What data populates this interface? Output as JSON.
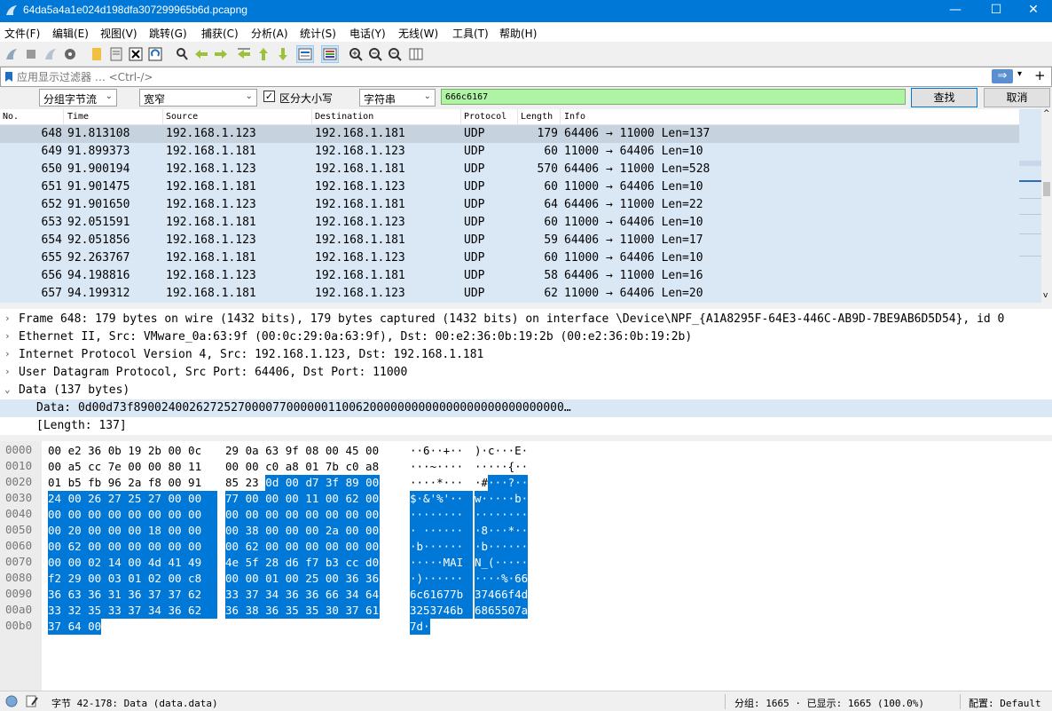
{
  "window": {
    "title": "64da5a4a1e024d198dfa307299965b6d.pcapng",
    "min": "—",
    "max": "☐",
    "close": "✕"
  },
  "menu": [
    "文件(F)",
    "编辑(E)",
    "视图(V)",
    "跳转(G)",
    "捕获(C)",
    "分析(A)",
    "统计(S)",
    "电话(Y)",
    "无线(W)",
    "工具(T)",
    "帮助(H)"
  ],
  "toolbar_icons": [
    "shark-fin-icon",
    "stop-icon",
    "restart-icon",
    "capture-options-icon",
    "open-file-icon",
    "save-file-icon",
    "close-file-icon",
    "reload-icon",
    "find-icon",
    "go-back-icon",
    "go-forward-icon",
    "go-to-packet-icon",
    "go-first-icon",
    "go-last-icon",
    "autoscroll-icon",
    "colorize-icon",
    "zoom-in-icon",
    "zoom-out-icon",
    "normal-size-icon",
    "resize-columns-icon"
  ],
  "filter": {
    "placeholder": "应用显示过滤器 … <Ctrl-/>",
    "apply": "⇒",
    "add": "+"
  },
  "find": {
    "search_in": "分组字节流",
    "char_width": "宽窄",
    "case_label": "区分大小写",
    "search_type": "字符串",
    "value": "666c6167",
    "find_button": "查找",
    "cancel_button": "取消"
  },
  "columns": [
    "No.",
    "Time",
    "Source",
    "Destination",
    "Protocol",
    "Length",
    "Info"
  ],
  "packets": [
    {
      "no": "648",
      "time": "91.813108",
      "src": "192.168.1.123",
      "dst": "192.168.1.181",
      "proto": "UDP",
      "len": "179",
      "info": "64406 → 11000 Len=137",
      "selected": true
    },
    {
      "no": "649",
      "time": "91.899373",
      "src": "192.168.1.181",
      "dst": "192.168.1.123",
      "proto": "UDP",
      "len": "60",
      "info": "11000 → 64406 Len=10"
    },
    {
      "no": "650",
      "time": "91.900194",
      "src": "192.168.1.123",
      "dst": "192.168.1.181",
      "proto": "UDP",
      "len": "570",
      "info": "64406 → 11000 Len=528"
    },
    {
      "no": "651",
      "time": "91.901475",
      "src": "192.168.1.181",
      "dst": "192.168.1.123",
      "proto": "UDP",
      "len": "60",
      "info": "11000 → 64406 Len=10"
    },
    {
      "no": "652",
      "time": "91.901650",
      "src": "192.168.1.123",
      "dst": "192.168.1.181",
      "proto": "UDP",
      "len": "64",
      "info": "64406 → 11000 Len=22"
    },
    {
      "no": "653",
      "time": "92.051591",
      "src": "192.168.1.181",
      "dst": "192.168.1.123",
      "proto": "UDP",
      "len": "60",
      "info": "11000 → 64406 Len=10"
    },
    {
      "no": "654",
      "time": "92.051856",
      "src": "192.168.1.123",
      "dst": "192.168.1.181",
      "proto": "UDP",
      "len": "59",
      "info": "64406 → 11000 Len=17"
    },
    {
      "no": "655",
      "time": "92.263767",
      "src": "192.168.1.181",
      "dst": "192.168.1.123",
      "proto": "UDP",
      "len": "60",
      "info": "11000 → 64406 Len=10"
    },
    {
      "no": "656",
      "time": "94.198816",
      "src": "192.168.1.123",
      "dst": "192.168.1.181",
      "proto": "UDP",
      "len": "58",
      "info": "64406 → 11000 Len=16"
    },
    {
      "no": "657",
      "time": "94.199312",
      "src": "192.168.1.181",
      "dst": "192.168.1.123",
      "proto": "UDP",
      "len": "62",
      "info": "11000 → 64406 Len=20"
    }
  ],
  "details": [
    {
      "toggle": ">",
      "indent": 0,
      "text": "Frame 648: 179 bytes on wire (1432 bits), 179 bytes captured (1432 bits) on interface \\Device\\NPF_{A1A8295F-64E3-446C-AB9D-7BE9AB6D5D54}, id 0"
    },
    {
      "toggle": ">",
      "indent": 0,
      "text": "Ethernet II, Src: VMware_0a:63:9f (00:0c:29:0a:63:9f), Dst: 00:e2:36:0b:19:2b (00:e2:36:0b:19:2b)"
    },
    {
      "toggle": ">",
      "indent": 0,
      "text": "Internet Protocol Version 4, Src: 192.168.1.123, Dst: 192.168.1.181"
    },
    {
      "toggle": ">",
      "indent": 0,
      "text": "User Datagram Protocol, Src Port: 64406, Dst Port: 11000"
    },
    {
      "toggle": "v",
      "indent": 0,
      "text": "Data (137 bytes)"
    },
    {
      "toggle": "",
      "indent": 1,
      "text": "Data: 0d00d73f89002400262725270000770000001100620000000000000000000000000000…",
      "selected": true
    },
    {
      "toggle": "",
      "indent": 1,
      "text": "[Length: 137]"
    }
  ],
  "bytes": [
    {
      "off": "0000",
      "h1": "00 e2 36 0b 19 2b 00 0c",
      "h2": "29 0a 63 9f 08 00 45 00",
      "a1": "··6··+··",
      "a2": ")·c···E·",
      "hl_from": 99
    },
    {
      "off": "0010",
      "h1": "00 a5 cc 7e 00 00 80 11",
      "h2": "00 00 c0 a8 01 7b c0 a8",
      "a1": "···~····",
      "a2": "·····{··",
      "hl_from": 99
    },
    {
      "off": "0020",
      "h1": "01 b5 fb 96 2a f8 00 91",
      "h2": "85 23 0d 00 d7 3f 89 00",
      "a1": "····*···",
      "a2": "·#···?··",
      "hl_from": 10
    },
    {
      "off": "0030",
      "h1": "24 00 26 27 25 27 00 00",
      "h2": "77 00 00 00 11 00 62 00",
      "a1": "$·&'%'··",
      "a2": "w·····b·",
      "hl_from": 0
    },
    {
      "off": "0040",
      "h1": "00 00 00 00 00 00 00 00",
      "h2": "00 00 00 00 00 00 00 00",
      "a1": "········",
      "a2": "········",
      "hl_from": 0
    },
    {
      "off": "0050",
      "h1": "00 20 00 00 00 18 00 00",
      "h2": "00 38 00 00 00 2a 00 00",
      "a1": "· ······",
      "a2": "·8···*··",
      "hl_from": 0
    },
    {
      "off": "0060",
      "h1": "00 62 00 00 00 00 00 00",
      "h2": "00 62 00 00 00 00 00 00",
      "a1": "·b······",
      "a2": "·b······",
      "hl_from": 0
    },
    {
      "off": "0070",
      "h1": "00 00 02 14 00 4d 41 49",
      "h2": "4e 5f 28 d6 f7 b3 cc d0",
      "a1": "·····MAI",
      "a2": "N_(·····",
      "hl_from": 0
    },
    {
      "off": "0080",
      "h1": "f2 29 00 03 01 02 00 c8",
      "h2": "00 00 01 00 25 00 36 36",
      "a1": "·)······",
      "a2": "····%·66",
      "hl_from": 0
    },
    {
      "off": "0090",
      "h1": "36 63 36 31 36 37 37 62",
      "h2": "33 37 34 36 36 66 34 64",
      "a1": "6c61677b",
      "a2": "37466f4d",
      "hl_from": 0
    },
    {
      "off": "00a0",
      "h1": "33 32 35 33 37 34 36 62",
      "h2": "36 38 36 35 35 30 37 61",
      "a1": "3253746b",
      "a2": "6865507a",
      "hl_from": 0
    },
    {
      "off": "00b0",
      "h1": "37 64 00",
      "h2": "",
      "a1": "7d·",
      "a2": "",
      "hl_from": 0
    }
  ],
  "status": {
    "field": "字节 42-178: Data (data.data)",
    "packets": "分组: 1665 · 已显示: 1665 (100.0%)",
    "profile": "配置: Default"
  },
  "colors": {
    "accent": "#0078d7",
    "row_bg": "#dae8f6",
    "selected_row": "#c6d3df",
    "find_ok": "#aff3a5"
  }
}
